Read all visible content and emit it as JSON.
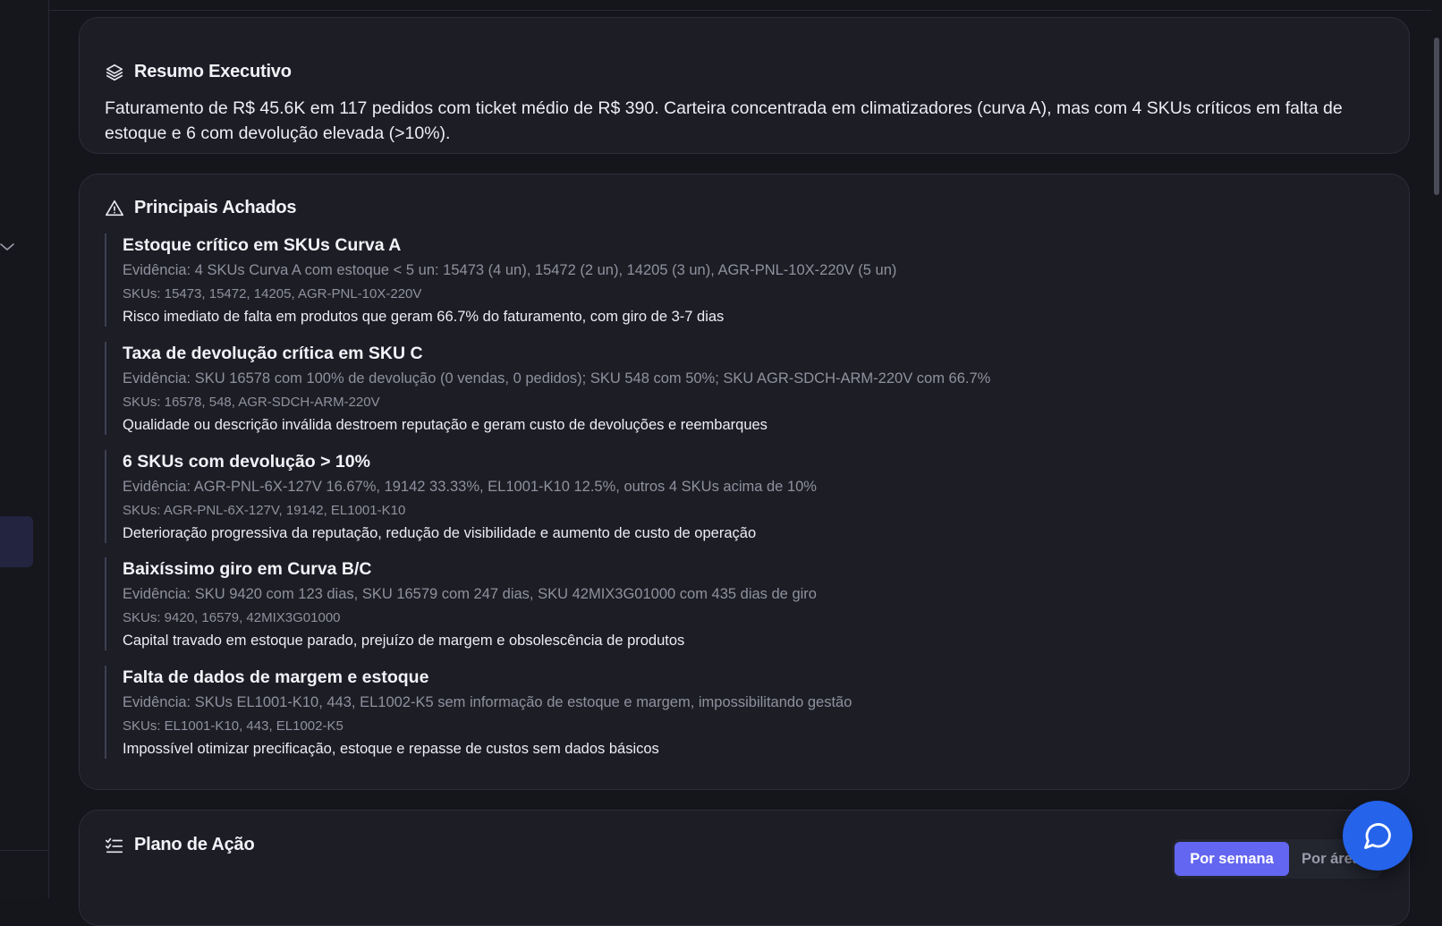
{
  "resumo": {
    "title": "Resumo Executivo",
    "icon": "layers-icon",
    "text": "Faturamento de R$ 45.6K em 117 pedidos com ticket médio de R$ 390. Carteira concentrada em climatizadores (curva A), mas com 4 SKUs críticos em falta de estoque e 6 com devolução elevada (>10%)."
  },
  "achados": {
    "title": "Principais Achados",
    "icon": "alert-triangle-icon",
    "items": [
      {
        "title": "Estoque crítico em SKUs Curva A",
        "evidence": "Evidência: 4 SKUs Curva A com estoque < 5 un: 15473 (4 un), 15472 (2 un), 14205 (3 un), AGR-PNL-10X-220V (5 un)",
        "skus": "SKUs: 15473, 15472, 14205, AGR-PNL-10X-220V",
        "impact": "Risco imediato de falta em produtos que geram 66.7% do faturamento, com giro de 3-7 dias"
      },
      {
        "title": "Taxa de devolução crítica em SKU C",
        "evidence": "Evidência: SKU 16578 com 100% de devolução (0 vendas, 0 pedidos); SKU 548 com 50%; SKU AGR-SDCH-ARM-220V com 66.7%",
        "skus": "SKUs: 16578, 548, AGR-SDCH-ARM-220V",
        "impact": "Qualidade ou descrição inválida destroem reputação e geram custo de devoluções e reembarques"
      },
      {
        "title": "6 SKUs com devolução > 10%",
        "evidence": "Evidência: AGR-PNL-6X-127V 16.67%, 19142 33.33%, EL1001-K10 12.5%, outros 4 SKUs acima de 10%",
        "skus": "SKUs: AGR-PNL-6X-127V, 19142, EL1001-K10",
        "impact": "Deterioração progressiva da reputação, redução de visibilidade e aumento de custo de operação"
      },
      {
        "title": "Baixíssimo giro em Curva B/C",
        "evidence": "Evidência: SKU 9420 com 123 dias, SKU 16579 com 247 dias, SKU 42MIX3G01000 com 435 dias de giro",
        "skus": "SKUs: 9420, 16579, 42MIX3G01000",
        "impact": "Capital travado em estoque parado, prejuízo de margem e obsolescência de produtos"
      },
      {
        "title": "Falta de dados de margem e estoque",
        "evidence": "Evidência: SKUs EL1001-K10, 443, EL1002-K5 sem informação de estoque e margem, impossibilitando gestão",
        "skus": "SKUs: EL1001-K10, 443, EL1002-K5",
        "impact": "Impossível otimizar precificação, estoque e repasse de custos sem dados básicos"
      }
    ]
  },
  "plano": {
    "title": "Plano de Ação",
    "icon": "list-checks-icon",
    "toggle_active": "Por semana",
    "toggle_other": "Por área"
  },
  "chat": {
    "icon": "message-circle-icon"
  },
  "colors": {
    "background": "#15161c",
    "card": "#1c1d25",
    "accent": "#6366f1",
    "fab": "#2563eb"
  }
}
